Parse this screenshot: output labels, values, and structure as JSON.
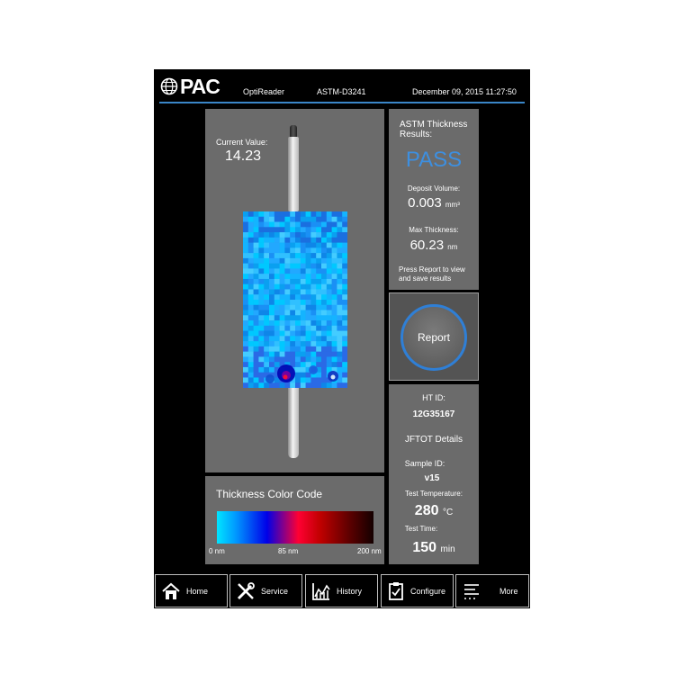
{
  "header": {
    "brand": "PAC",
    "app_name": "OptiReader",
    "method": "ASTM-D3241",
    "datetime": "December 09, 2015 11:27:50"
  },
  "tube": {
    "current_value_label": "Current Value:",
    "current_value": "14.23"
  },
  "color_code": {
    "title": "Thickness Color Code",
    "ticks": [
      "0 nm",
      "85 nm",
      "200 nm"
    ]
  },
  "results": {
    "title": "ASTM Thickness Results:",
    "status": "PASS",
    "status_color": "#3d8fe0",
    "deposit_volume_label": "Deposit Volume:",
    "deposit_volume_value": "0.003",
    "deposit_volume_unit": "mm³",
    "max_thickness_label": "Max Thickness:",
    "max_thickness_value": "60.23",
    "max_thickness_unit": "nm",
    "note": "Press Report to view and save results"
  },
  "report": {
    "label": "Report",
    "accent": "#2f7fd6"
  },
  "details": {
    "ht_id_label": "HT ID:",
    "ht_id": "12G35167",
    "section_title": "JFTOT Details",
    "sample_id_label": "Sample ID:",
    "sample_id": "v15",
    "test_temperature_label": "Test Temperature:",
    "test_temperature": "280",
    "test_temperature_unit": "°C",
    "test_time_label": "Test Time:",
    "test_time": "150",
    "test_time_unit": "min"
  },
  "nav": {
    "home": "Home",
    "service": "Service",
    "history": "History",
    "configure": "Configure",
    "more": "More"
  }
}
